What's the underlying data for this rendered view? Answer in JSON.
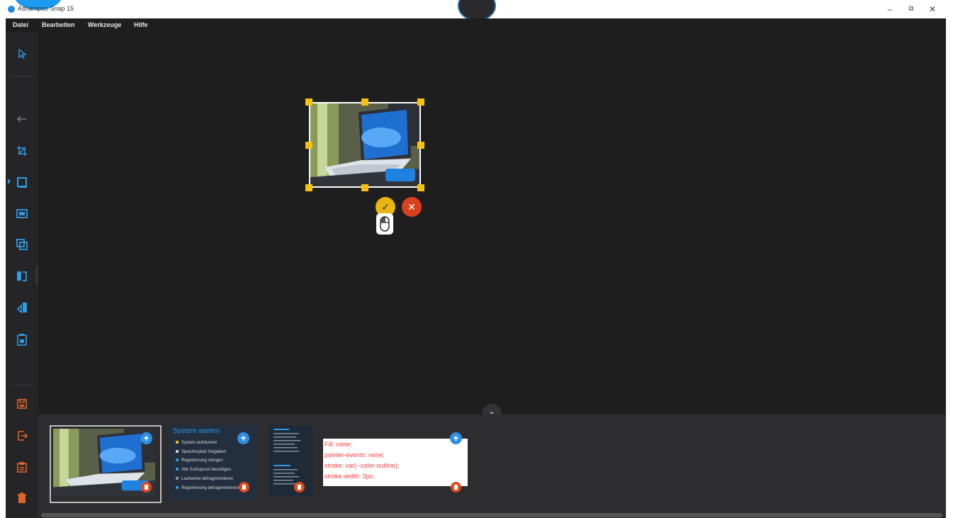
{
  "window": {
    "title": "Ashampoo Snap 15",
    "minimize": "–",
    "restore": "⧉",
    "close": "✕"
  },
  "menu": [
    {
      "label": "Datei"
    },
    {
      "label": "Bearbeiten"
    },
    {
      "label": "Werkzeuge"
    },
    {
      "label": "Hilfe"
    }
  ],
  "toolbar": {
    "tools": [
      {
        "name": "select-icon",
        "color": "#2e9be6"
      },
      {
        "name": "back-arrow-icon",
        "color": "#888888"
      },
      {
        "name": "crop-icon",
        "color": "#2e9be6"
      },
      {
        "name": "frame-icon",
        "color": "#2e9be6",
        "active": true
      },
      {
        "name": "window-icon",
        "color": "#2e9be6"
      },
      {
        "name": "overlay-icon",
        "color": "#2e9be6"
      },
      {
        "name": "rotate-icon",
        "color": "#2e9be6"
      },
      {
        "name": "flip-icon",
        "color": "#2e9be6"
      },
      {
        "name": "clipboard-image-icon",
        "color": "#2e9be6"
      },
      {
        "name": "save-icon",
        "color": "#e0632a"
      },
      {
        "name": "export-icon",
        "color": "#e0632a"
      },
      {
        "name": "copy-icon",
        "color": "#e0632a"
      },
      {
        "name": "delete-icon",
        "color": "#e0632a"
      }
    ]
  },
  "canvas": {
    "confirm_glyph": "✓",
    "cancel_glyph": "✕"
  },
  "tray": {
    "toggle_glyph": "⌄",
    "items": [
      {
        "type": "photo"
      },
      {
        "type": "checklist",
        "title": "System warten",
        "lines": [
          "System aufräumen",
          "Speicherplatz freigeben",
          "Registrierung reinigen",
          "Alle Surfspuren beseitigen",
          "Laufwerke defragmentieren",
          "Registrierung defragmentieren"
        ]
      },
      {
        "type": "mini-document"
      },
      {
        "type": "code",
        "lines": [
          "Fill: none;",
          "pointer-events: none;",
          "stroke: var(--color-outline);",
          "stroke-width: 3px;"
        ]
      }
    ]
  },
  "colors": {
    "accent": "#2e9be6",
    "handle": "#f5c211",
    "danger": "#e2491e",
    "canvas_bg": "#1e1e1e",
    "code_text": "#ff3a3a"
  }
}
